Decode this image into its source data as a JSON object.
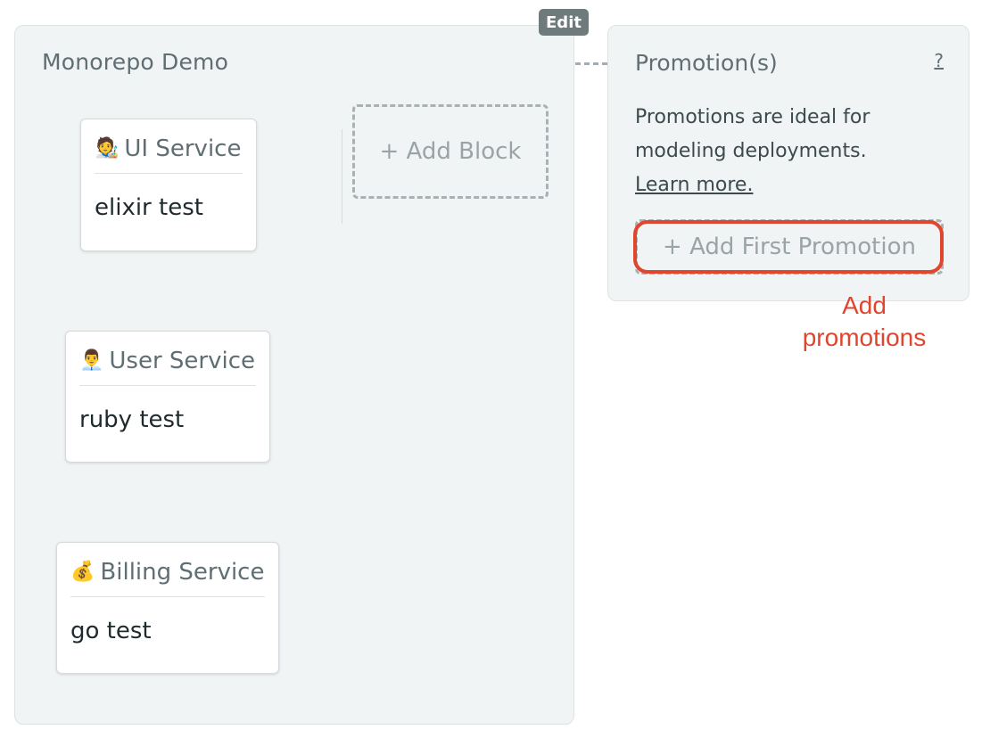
{
  "pipeline": {
    "title": "Monorepo Demo",
    "edit_label": "Edit",
    "add_block_label": "+ Add Block",
    "blocks": [
      {
        "emoji": "🧑‍🎨",
        "icon_name": "artist-icon",
        "name": "UI Service",
        "job": "elixir test"
      },
      {
        "emoji": "👨‍💼",
        "icon_name": "office-worker-icon",
        "name": "User Service",
        "job": "ruby test"
      },
      {
        "emoji": "💰",
        "icon_name": "money-bag-icon",
        "name": "Billing Service",
        "job": "go test"
      }
    ]
  },
  "promotions": {
    "title": "Promotion(s)",
    "help_label": "?",
    "description": "Promotions are ideal for modeling deployments.",
    "learn_more": "Learn more.",
    "add_first_label": "+ Add First Promotion"
  },
  "annotation": {
    "text": "Add promotions",
    "color": "#e0452e"
  },
  "colors": {
    "panel_bg": "#f1f4f5",
    "edit_badge_bg": "#6f7a7d",
    "muted_text": "#5f6e72",
    "dashed_border": "#a9b1b4"
  }
}
